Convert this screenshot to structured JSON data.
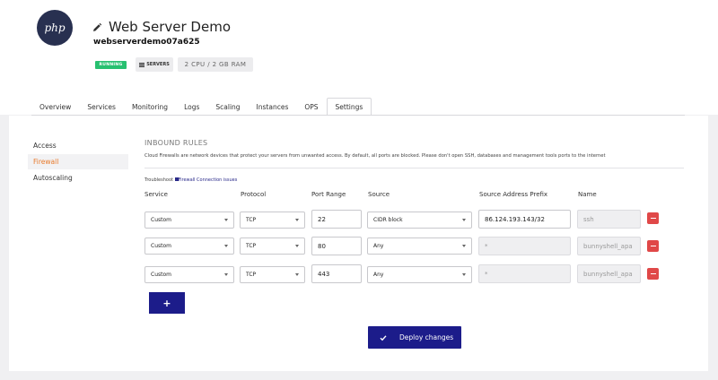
{
  "header": {
    "logo_text": "php",
    "title": "Web Server Demo",
    "subtitle": "webserverdemo07a625",
    "status_badge": "RUNNING",
    "servers_badge": "SERVERS",
    "spec_badge": "2 CPU / 2 GB RAM"
  },
  "tabs": [
    "Overview",
    "Services",
    "Monitoring",
    "Logs",
    "Scaling",
    "Instances",
    "OPS",
    "Settings"
  ],
  "active_tab": "Settings",
  "sidebar": [
    "Access",
    "Firewall",
    "Autoscaling"
  ],
  "active_sidebar": "Firewall",
  "rules_section": {
    "heading": "INBOUND RULES",
    "description": "Cloud Firewalls are network devices that protect your servers from unwanted access. By default, all ports are blocked. Please don't open SSH, databases and management tools ports to the internet",
    "troubleshoot_prefix": "Troubleshoot",
    "troubleshoot_link": "Firewall Connection issues",
    "columns": {
      "service": "Service",
      "protocol": "Protocol",
      "port_range": "Port Range",
      "source": "Source",
      "source_prefix": "Source Address Prefix",
      "name": "Name"
    },
    "rows": [
      {
        "service": "Custom",
        "protocol": "TCP",
        "port": "22",
        "source": "CIDR block",
        "prefix": "86.124.193.143/32",
        "name": "ssh"
      },
      {
        "service": "Custom",
        "protocol": "TCP",
        "port": "80",
        "source": "Any",
        "prefix": "*",
        "name": "bunnyshell_apa"
      },
      {
        "service": "Custom",
        "protocol": "TCP",
        "port": "443",
        "source": "Any",
        "prefix": "*",
        "name": "bunnyshell_apa"
      }
    ],
    "add_label": "+",
    "deploy_label": "Deploy changes"
  },
  "colors": {
    "accent": "#1c1c8a",
    "running": "#27c070",
    "delete": "#e04848",
    "active_sidebar": "#e87a2b"
  },
  "icons": {
    "edit": "pencil-icon",
    "servers": "servers-icon",
    "link": "link-icon",
    "delete": "minus-icon",
    "deploy": "check-icon",
    "dropdown": "chevron-down-icon"
  }
}
